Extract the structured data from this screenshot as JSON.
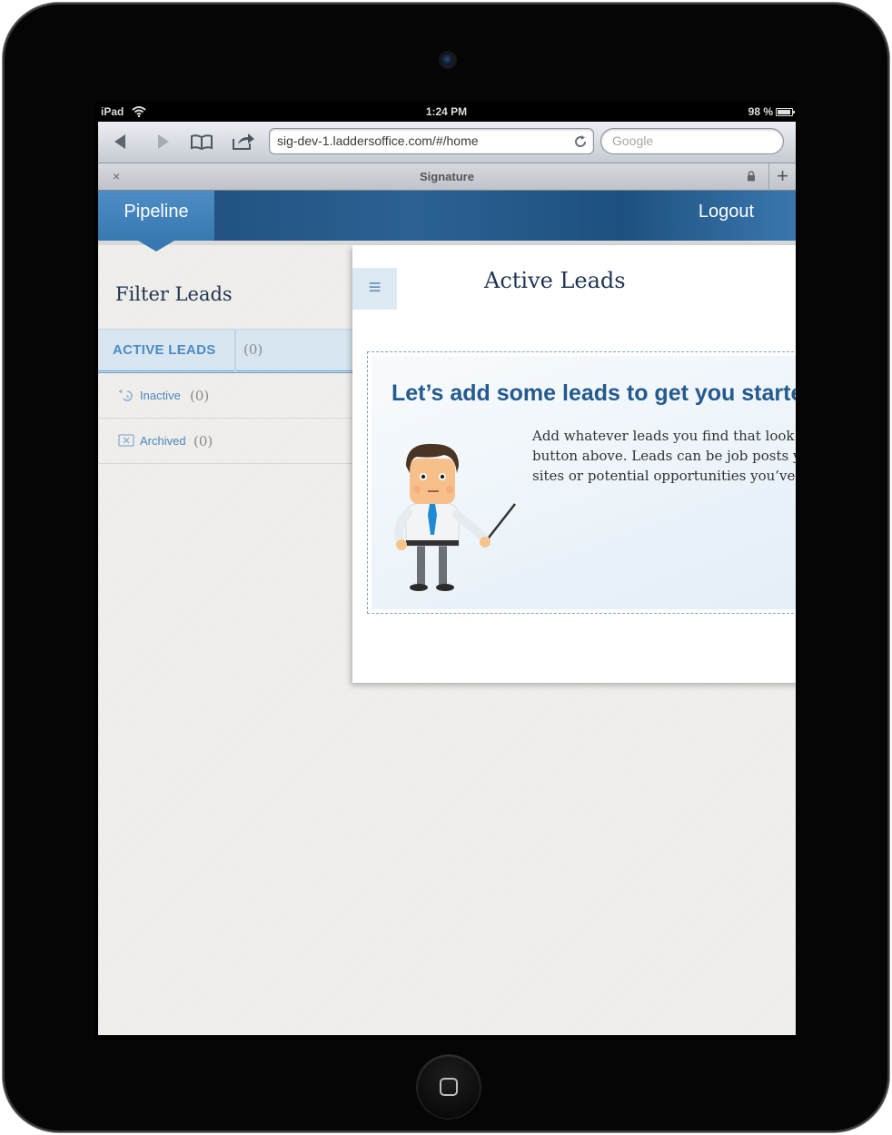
{
  "statusbar": {
    "carrier": "iPad",
    "time": "1:24 PM",
    "battery": "98 %"
  },
  "browser": {
    "url": "sig-dev-1.laddersoffice.com/#/home",
    "search_placeholder": "Google",
    "tab_title": "Signature",
    "tab_close": "×",
    "new_tab": "+"
  },
  "header": {
    "nav_pipeline": "Pipeline",
    "logout": "Logout"
  },
  "sidebar": {
    "title": "Filter Leads",
    "active": {
      "label": "ACTIVE LEADS",
      "count": "(0)"
    },
    "items": [
      {
        "label": "Inactive",
        "count": "(0)",
        "icon": "inactive-icon"
      },
      {
        "label": "Archived",
        "count": "(0)",
        "icon": "archived-icon"
      }
    ]
  },
  "main": {
    "menu_glyph": "≡",
    "title": "Active Leads",
    "onboarding": {
      "heading": "Let’s add some leads to get you started",
      "body_lines": [
        "Add whatever leads you find that look",
        "button above. Leads can be job posts y",
        "sites or potential opportunities you’ve"
      ]
    }
  },
  "colors": {
    "header_blue": "#2c6194",
    "accent_blue": "#4d8bc3",
    "active_row_bg": "#d8e6f1"
  }
}
